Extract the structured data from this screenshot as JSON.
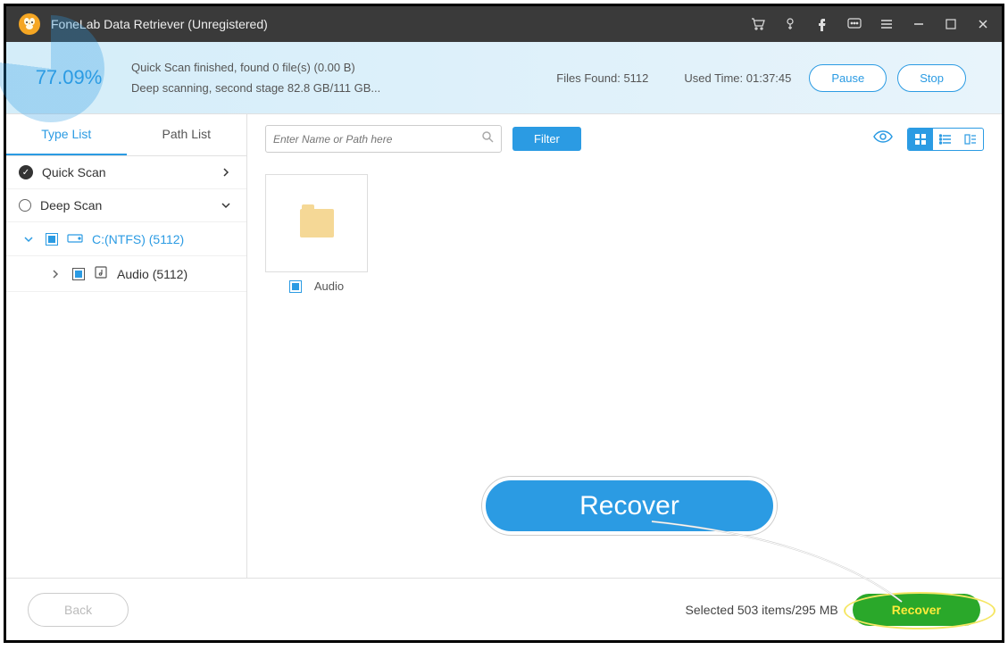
{
  "titlebar": {
    "title": "FoneLab Data Retriever (Unregistered)"
  },
  "status": {
    "percent": "77.09%",
    "line1": "Quick Scan finished, found 0 file(s) (0.00  B)",
    "line2": "Deep scanning, second stage 82.8 GB/111 GB...",
    "files_found_label": "Files Found: 5112",
    "used_time_label": "Used Time: 01:37:45",
    "pause": "Pause",
    "stop": "Stop"
  },
  "tabs": {
    "type_list": "Type List",
    "path_list": "Path List"
  },
  "tree": {
    "quick_scan": "Quick Scan",
    "deep_scan": "Deep Scan",
    "drive": "C:(NTFS) (5112)",
    "audio": "Audio (5112)"
  },
  "toolbar": {
    "search_placeholder": "Enter Name or Path here",
    "filter": "Filter"
  },
  "grid": {
    "audio_label": "Audio"
  },
  "bottom": {
    "back": "Back",
    "selected": "Selected 503 items/295 MB",
    "recover": "Recover"
  },
  "callout": {
    "text": "Recover"
  }
}
